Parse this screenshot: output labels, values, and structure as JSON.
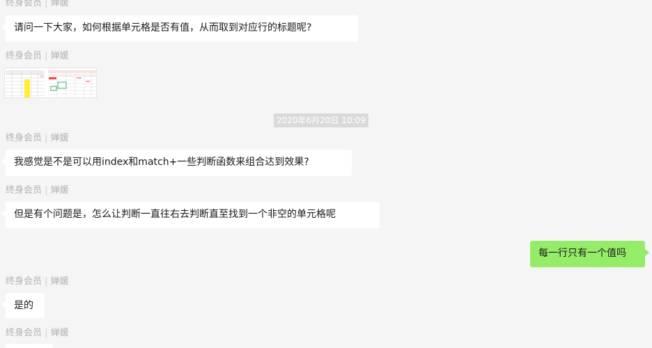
{
  "messages": [
    {
      "sender_level": "终身会员",
      "sender_name": "婵媛"
    },
    {
      "sender_level": "终身会员",
      "sender_name": "婵媛",
      "text": "请问一下大家，如何根据单元格是否有值，从而取到对应行的标题呢?"
    },
    {
      "sender_level": "终身会员",
      "sender_name": "婵媛",
      "attachment": "spreadsheet-image"
    },
    {
      "sender_level": "终身会员",
      "sender_name": "婵媛",
      "text": "我感觉是不是可以用index和match+一些判断函数来组合达到效果?"
    },
    {
      "sender_level": "终身会员",
      "sender_name": "婵媛",
      "text": "但是有个问题是，怎么让判断一直往右去判断直至找到一个非空的单元格呢"
    },
    {
      "self": true,
      "text": "每一行只有一个值吗"
    },
    {
      "sender_level": "终身会员",
      "sender_name": "婵媛",
      "text": "是的"
    },
    {
      "sender_level": "终身会员",
      "sender_name": "婵媛"
    }
  ],
  "timestamp": "2020年6月20日 10:09",
  "colors": {
    "background": "#f5f5f5",
    "bubble_other": "#ffffff",
    "bubble_self": "#95ec69",
    "sender_text": "#b2b2b2",
    "timestamp_bg": "#dadada"
  }
}
